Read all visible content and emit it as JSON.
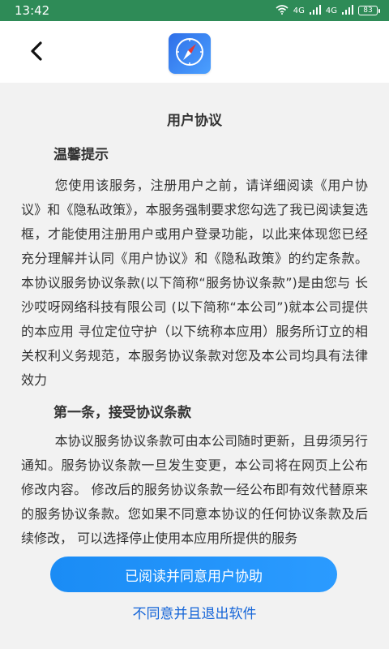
{
  "status_bar": {
    "time": "13:42",
    "network_label_1": "4G",
    "network_label_2": "4G",
    "battery": "83"
  },
  "header": {
    "back_icon": "chevron-left-icon",
    "logo_icon": "compass-icon"
  },
  "document": {
    "title": "用户协议",
    "section1_heading": "温馨提示",
    "section1_text": "您使用该服务，注册用户之前，请详细阅读《用户协议》和《隐私政策》，本服务强制要求您勾选了我已阅读复选框，才能使用注册用户或用户登录功能，以此来体现您已经充分理解并认同《用户协议》和《隐私政策》的约定条款。 本协议服务协议条款(以下简称“服务协议条款”)是由您与 长沙哎呀网络科技有限公司 (以下简称“本公司”)就本公司提供的本应用 寻位定位守护（以下统称本应用）服务所订立的相关权利义务规范，本服务协议条款对您及本公司均具有法律效力",
    "section2_heading": "第一条，接受协议条款",
    "section2_text": "本协议服务协议条款可由本公司随时更新，且毋须另行通知。服务协议条款一旦发生变更，本公司将在网页上公布修改内容。 修改后的服务协议条款一经公布即有效代替原来的服务协议条款。您如果不同意本协议的任何协议条款及后续修改， 可以选择停止使用本应用所提供的服务"
  },
  "actions": {
    "agree_label": "已阅读并同意用户协助",
    "disagree_label": "不同意并且退出软件"
  },
  "colors": {
    "status_bar": "#2e8b57",
    "accent": "#1a8cf5",
    "link": "#1565d8"
  }
}
